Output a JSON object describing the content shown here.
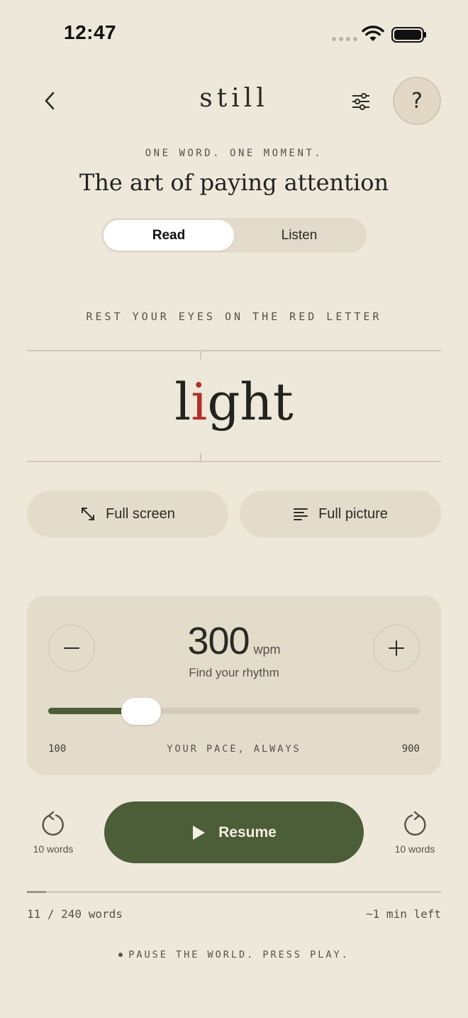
{
  "status_bar": {
    "time": "12:47"
  },
  "header": {
    "logo": "still",
    "help_label": "?"
  },
  "intro": {
    "tagline": "ONE WORD. ONE MOMENT.",
    "headline": "The art of paying attention"
  },
  "mode_tabs": [
    {
      "label": "Read",
      "active": true
    },
    {
      "label": "Listen",
      "active": false
    }
  ],
  "reader": {
    "hint": "REST YOUR EYES ON THE RED LETTER",
    "word_before": "l",
    "word_focus": "i",
    "word_after": "ght",
    "focus_color": "#B3302A"
  },
  "view_actions": {
    "full_screen_label": "Full screen",
    "full_picture_label": "Full picture"
  },
  "pace": {
    "value": "300",
    "unit": "wpm",
    "subtitle": "Find your rhythm",
    "min": "100",
    "max": "900",
    "caption": "YOUR PACE, ALWAYS",
    "slider_fraction": 0.25
  },
  "playback": {
    "back_label": "10 words",
    "forward_label": "10 words",
    "resume_label": "Resume",
    "accent": "#4B5E37"
  },
  "progress": {
    "count_text": "11 / 240 words",
    "remaining_text": "~1 min left",
    "fraction": 0.0458
  },
  "footer": {
    "text": "PAUSE THE WORLD. PRESS PLAY."
  }
}
